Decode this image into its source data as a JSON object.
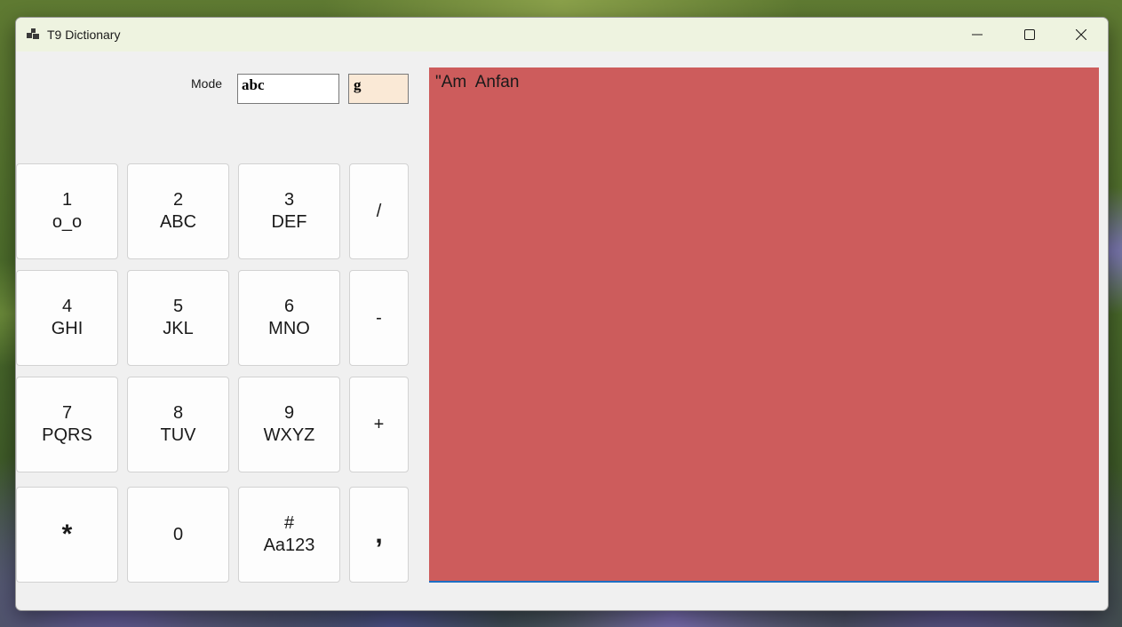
{
  "window": {
    "title": "T9 Dictionary",
    "icons": [
      "app-icon",
      "minimize-icon",
      "maximize-icon",
      "close-icon"
    ]
  },
  "mode": {
    "label": "Mode",
    "value": "abc",
    "current_char": "g"
  },
  "keypad": {
    "k1": {
      "digit": "1",
      "letters": "o_o"
    },
    "k2": {
      "digit": "2",
      "letters": "ABC"
    },
    "k3": {
      "digit": "3",
      "letters": "DEF"
    },
    "kslash": {
      "label": "/"
    },
    "k4": {
      "digit": "4",
      "letters": "GHI"
    },
    "k5": {
      "digit": "5",
      "letters": "JKL"
    },
    "k6": {
      "digit": "6",
      "letters": "MNO"
    },
    "kminus": {
      "label": "-"
    },
    "k7": {
      "digit": "7",
      "letters": "PQRS"
    },
    "k8": {
      "digit": "8",
      "letters": "TUV"
    },
    "k9": {
      "digit": "9",
      "letters": "WXYZ"
    },
    "kplus": {
      "label": "+"
    },
    "kstar": {
      "label": "*"
    },
    "k0": {
      "label": "0"
    },
    "khash": {
      "digit": "#",
      "letters": "Aa123"
    },
    "kcomma": {
      "label": ","
    }
  },
  "editor": {
    "text": "\"Am  Anfan",
    "background_color": "#cd5c5c"
  }
}
